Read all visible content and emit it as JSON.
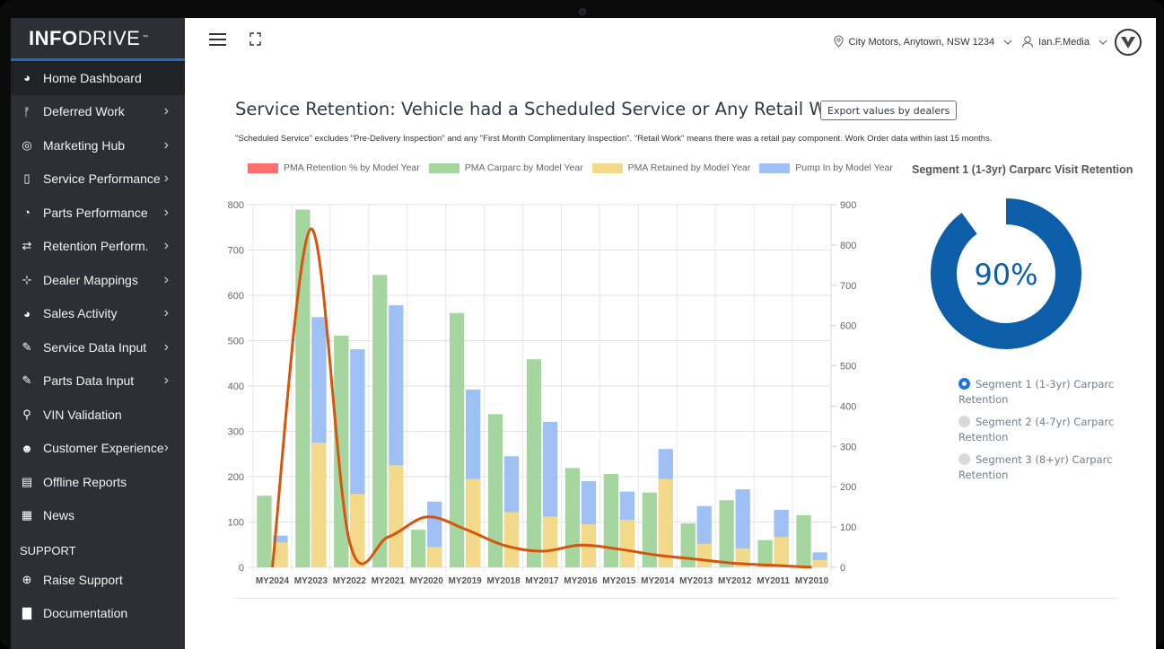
{
  "app": {
    "logo_bold": "INFO",
    "logo_rest": "DRIVE",
    "logo_mark": "™"
  },
  "sidebar": {
    "items": [
      {
        "label": "Home Dashboard",
        "icon": "dashboard-icon",
        "glyph": "◕",
        "chevron": false
      },
      {
        "label": "Deferred Work",
        "icon": "branch-icon",
        "glyph": "ᚠ",
        "chevron": true
      },
      {
        "label": "Marketing Hub",
        "icon": "globe-icon",
        "glyph": "◎",
        "chevron": true
      },
      {
        "label": "Service Performance",
        "icon": "bar-chart-icon",
        "glyph": "▯",
        "chevron": true
      },
      {
        "label": "Parts Performance",
        "icon": "pie-chart-icon",
        "glyph": "◔",
        "chevron": true
      },
      {
        "label": "Retention Perform.",
        "icon": "retweet-icon",
        "glyph": "⇄",
        "chevron": true
      },
      {
        "label": "Dealer Mappings",
        "icon": "sitemap-icon",
        "glyph": "⊹",
        "chevron": true
      },
      {
        "label": "Sales Activity",
        "icon": "car-icon",
        "glyph": "◕",
        "chevron": true
      },
      {
        "label": "Service Data Input",
        "icon": "pencil-icon",
        "glyph": "✎",
        "chevron": true
      },
      {
        "label": "Parts Data Input",
        "icon": "pencil-icon",
        "glyph": "✎",
        "chevron": true
      },
      {
        "label": "VIN Validation",
        "icon": "search-icon",
        "glyph": "⚲",
        "chevron": false
      },
      {
        "label": "Customer Experience",
        "icon": "smile-icon",
        "glyph": "☻",
        "chevron": true
      },
      {
        "label": "Offline Reports",
        "icon": "archive-icon",
        "glyph": "▤",
        "chevron": false
      },
      {
        "label": "News",
        "icon": "newspaper-icon",
        "glyph": "▦",
        "chevron": false
      }
    ],
    "support_heading": "SUPPORT",
    "support_items": [
      {
        "label": "Raise Support",
        "icon": "lifebuoy-icon",
        "glyph": "⊕"
      },
      {
        "label": "Documentation",
        "icon": "document-icon",
        "glyph": "▇"
      }
    ]
  },
  "topbar": {
    "location": "City Motors, Anytown, NSW 1234",
    "user": "Ian.F.Media"
  },
  "main": {
    "title": "Service Retention: Vehicle had a Scheduled Service or Any Retail Work",
    "export_label": "Export values by dealers",
    "note": "\"Scheduled Service\" excludes \"Pre-Delivery Inspection\" and any \"First Month Complimentary Inspection\". \"Retail Work\" means there was a retail pay component. Work Order data within last 15 months."
  },
  "chart_data": {
    "type": "bar",
    "categories": [
      "MY2024",
      "MY2023",
      "MY2022",
      "MY2021",
      "MY2020",
      "MY2019",
      "MY2018",
      "MY2017",
      "MY2016",
      "MY2015",
      "MY2014",
      "MY2013",
      "MY2012",
      "MY2011",
      "MY2010"
    ],
    "series": [
      {
        "name": "PMA Retention % by Model Year",
        "type": "line",
        "axis": "right",
        "color": "#ff6f6f",
        "values": [
          0,
          840,
          65,
          75,
          125,
          95,
          55,
          40,
          55,
          45,
          30,
          20,
          10,
          5,
          0
        ]
      },
      {
        "name": "PMA Carparc by Model Year",
        "type": "bar",
        "axis": "left",
        "color": "#a5d6a0",
        "values": [
          158,
          789,
          511,
          645,
          83,
          561,
          338,
          459,
          219,
          206,
          165,
          97,
          148,
          60,
          115
        ]
      },
      {
        "name": "PMA Retained by Model Year",
        "type": "bar",
        "axis": "left",
        "color": "#f3d98a",
        "values": [
          55,
          275,
          162,
          225,
          45,
          195,
          122,
          112,
          95,
          105,
          195,
          52,
          42,
          67,
          16
        ]
      },
      {
        "name": "Pump In by Model Year",
        "type": "bar",
        "axis": "left",
        "color": "#9fc0f5",
        "values": [
          70,
          552,
          481,
          578,
          145,
          392,
          245,
          321,
          190,
          167,
          261,
          135,
          172,
          127,
          33
        ]
      }
    ],
    "line_color": "#d4550b",
    "ylim": [
      0,
      800
    ],
    "y2lim": [
      0,
      900
    ],
    "yticks": [
      0,
      100,
      200,
      300,
      400,
      500,
      600,
      700,
      800
    ],
    "y2ticks": [
      0,
      100,
      200,
      300,
      400,
      500,
      600,
      700,
      800,
      900
    ],
    "grid": true,
    "legend": "top"
  },
  "segment": {
    "title": "Segment 1 (1-3yr) Carparc Visit Retention",
    "value_label": "90%",
    "value": 0.9,
    "color": "#0d5ea8",
    "options": [
      {
        "label": "Segment 1 (1-3yr) Carparc Retention",
        "selected": true
      },
      {
        "label": "Segment 2 (4-7yr) Carparc Retention",
        "selected": false
      },
      {
        "label": "Segment 3 (8+yr) Carparc Retention",
        "selected": false
      }
    ]
  }
}
